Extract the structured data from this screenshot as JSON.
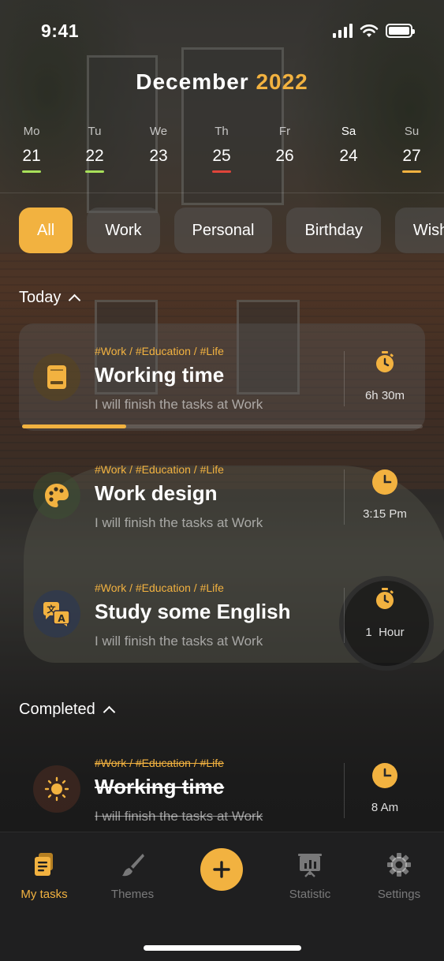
{
  "status_bar": {
    "time": "9:41"
  },
  "header": {
    "month": "December",
    "year": "2022"
  },
  "week": [
    {
      "day": "Mo",
      "date": "21",
      "mark_color": "#a8e05a"
    },
    {
      "day": "Tu",
      "date": "22",
      "mark_color": "#a8e05a"
    },
    {
      "day": "We",
      "date": "23",
      "mark_color": ""
    },
    {
      "day": "Th",
      "date": "25",
      "mark_color": "#e0453a"
    },
    {
      "day": "Fr",
      "date": "26",
      "mark_color": ""
    },
    {
      "day": "Sa",
      "date": "24",
      "mark_color": ""
    },
    {
      "day": "Su",
      "date": "27",
      "mark_color": "#f2b240"
    }
  ],
  "filters": [
    "All",
    "Work",
    "Personal",
    "Birthday",
    "Wish"
  ],
  "sections": {
    "today": "Today",
    "completed": "Completed"
  },
  "tasks_today": [
    {
      "tags": "#Work / #Education / #Life",
      "title": "Working time",
      "desc": "I will finish the tasks at Work",
      "meta": "6h 30m",
      "icon": "book-icon",
      "meta_icon": "stopwatch-icon",
      "progress": 0.27
    },
    {
      "tags": "#Work / #Education / #Life",
      "title": "Work design",
      "desc": "I will finish the tasks at Work",
      "meta": "3:15 Pm",
      "icon": "palette-icon",
      "meta_icon": "clock-icon"
    },
    {
      "tags": "#Work / #Education / #Life",
      "title": "Study some English",
      "desc": "I will finish the tasks at Work",
      "meta": "1  Hour",
      "icon": "translate-icon",
      "meta_icon": "stopwatch-icon"
    }
  ],
  "tasks_completed": [
    {
      "tags": "#Work / #Education / #Life",
      "title": "Working time",
      "desc": "I will finish the tasks at Work",
      "meta": "8 Am",
      "icon": "sun-icon",
      "meta_icon": "clock-icon"
    }
  ],
  "nav": {
    "my_tasks": "My tasks",
    "themes": "Themes",
    "statistic": "Statistic",
    "settings": "Settings"
  },
  "colors": {
    "accent": "#f2b240"
  }
}
